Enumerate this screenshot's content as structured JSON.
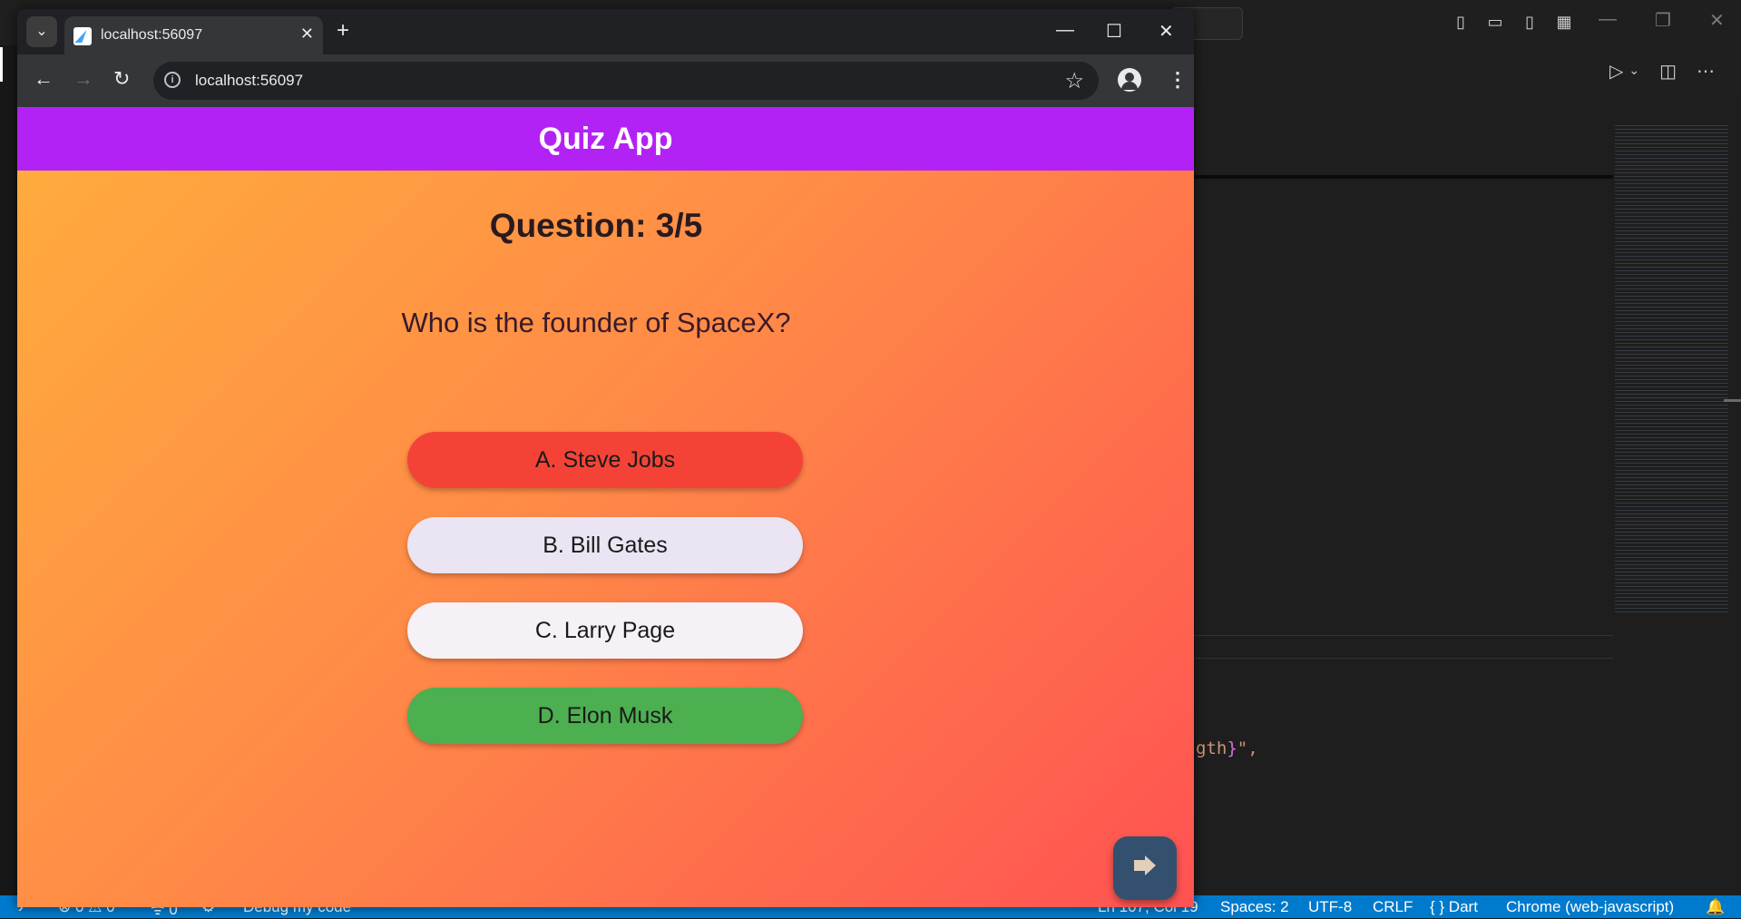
{
  "browser": {
    "tab_title": "localhost:56097",
    "url": "localhost:56097"
  },
  "app": {
    "title": "Quiz App",
    "question_counter": "Question: 3/5",
    "question_text": "Who is the founder of SpaceX?",
    "answers": [
      {
        "label": "A. Steve Jobs",
        "state": "incorrect",
        "color": "#f44336"
      },
      {
        "label": "B. Bill Gates",
        "state": "neutral",
        "color": "#ebe4f2"
      },
      {
        "label": "C. Larry Page",
        "state": "neutral",
        "color": "#f6f0f7"
      },
      {
        "label": "D. Elon Musk",
        "state": "correct",
        "color": "#4caf50"
      }
    ],
    "appbar_color": "#b322f5",
    "gradient": [
      "#ffab3d",
      "#ff5252"
    ],
    "next_icon": "arrow-forward-icon"
  },
  "editor": {
    "code_snippet_text": "gth",
    "code_snippet_brace": "}",
    "code_snippet_tail": "\",",
    "status_bar": {
      "errors": "0",
      "warnings": "0",
      "ports": "0",
      "debug": "Debug my code",
      "position": "Ln 107, Col 19",
      "spaces": "Spaces: 2",
      "encoding": "UTF-8",
      "eol": "CRLF",
      "language": "{ } Dart",
      "target": "Chrome (web-javascript)"
    }
  }
}
